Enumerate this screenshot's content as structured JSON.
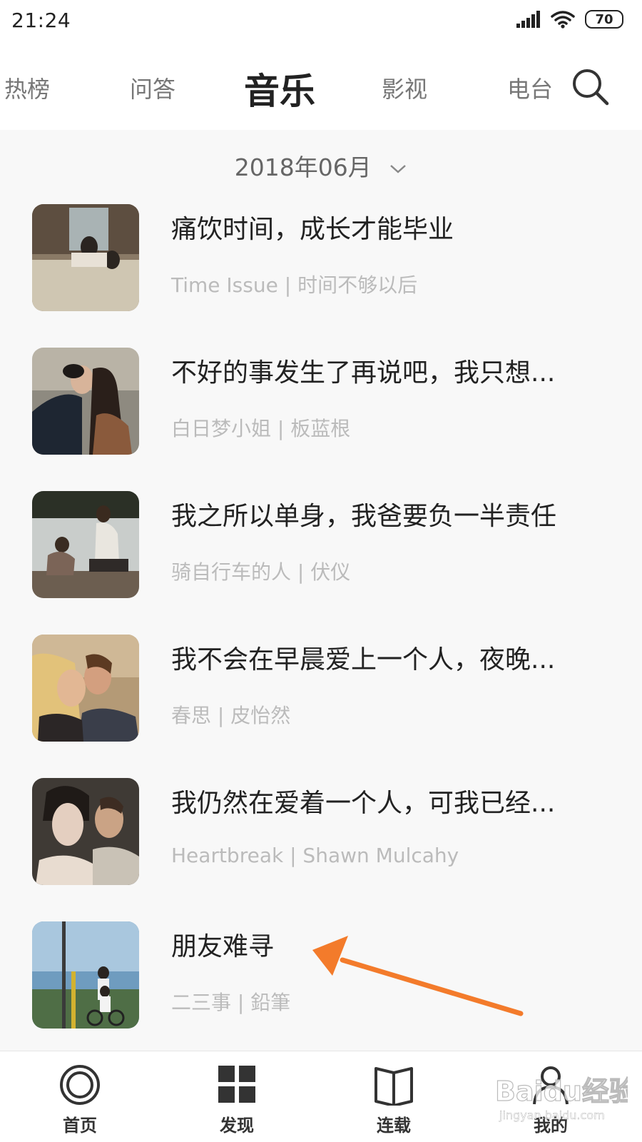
{
  "status_bar": {
    "time": "21:24",
    "battery": "70"
  },
  "nav": {
    "tabs": [
      "热榜",
      "问答",
      "音乐",
      "影视",
      "电台"
    ],
    "active": "音乐"
  },
  "date_picker": {
    "label": "2018年06月"
  },
  "songs": [
    {
      "title": "痛饮时间，成长才能毕业",
      "subtitle": "Time Issue | 时间不够以后"
    },
    {
      "title": "不好的事发生了再说吧，我只想...",
      "subtitle": "白日梦小姐 | 板蓝根"
    },
    {
      "title": "我之所以单身，我爸要负一半责任",
      "subtitle": "骑自行车的人 | 伏仪"
    },
    {
      "title": "我不会在早晨爱上一个人，夜晚...",
      "subtitle": "春思 | 皮怡然"
    },
    {
      "title": "我仍然在爱着一个人，可我已经...",
      "subtitle": "Heartbreak | Shawn Mulcahy"
    },
    {
      "title": "朋友难寻",
      "subtitle": "二三事 | 鉛筆"
    }
  ],
  "bottom_nav": [
    {
      "label": "首页",
      "icon": "home-circle-icon"
    },
    {
      "label": "发现",
      "icon": "grid-icon"
    },
    {
      "label": "连载",
      "icon": "book-icon"
    },
    {
      "label": "我的",
      "icon": "person-icon"
    }
  ],
  "annotation": {
    "color": "#f37b2b"
  },
  "watermark": {
    "text": "Baidu经验",
    "sub": "jingyan.baidu.com"
  }
}
